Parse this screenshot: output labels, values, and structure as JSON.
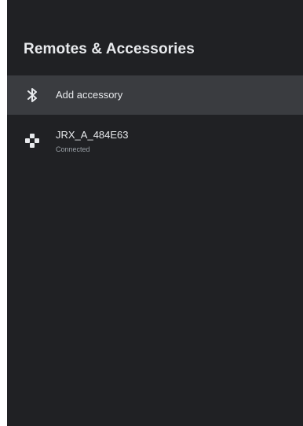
{
  "header": {
    "title": "Remotes & Accessories"
  },
  "items": [
    {
      "label": "Add accessory",
      "icon": "bluetooth-icon"
    },
    {
      "label": "JRX_A_484E63",
      "status": "Connected",
      "icon": "gamepad-icon"
    }
  ],
  "colors": {
    "background": "#202124",
    "selected_row": "#3a3c40",
    "text_primary": "#e8eaed",
    "text_secondary": "#9aa0a6"
  }
}
